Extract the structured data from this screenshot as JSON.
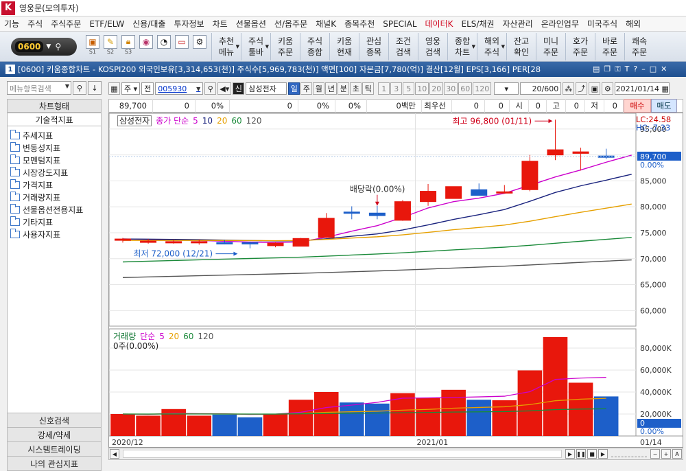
{
  "app": {
    "title": "영웅문(모의투자)",
    "logo_char": "K"
  },
  "menu": [
    "기능",
    "주식",
    "주식주문",
    "ETF/ELW",
    "신용/대출",
    "투자정보",
    "차트",
    "선물옵션",
    "선/옵주문",
    "채널K",
    "종목추천",
    "SPECIAL",
    "데이터K",
    "ELS/채권",
    "자산관리",
    "온라인업무",
    "미국주식",
    "해외"
  ],
  "menu_highlight": "데이터K",
  "toolbar": {
    "code": "0600",
    "quick_labels": [
      "S1",
      "S2",
      "S3"
    ],
    "buttons": [
      {
        "l1": "추천",
        "l2": "메뉴",
        "caret": true
      },
      {
        "l1": "주식",
        "l2": "툴바",
        "caret": true
      },
      {
        "l1": "키움",
        "l2": "주문"
      },
      {
        "l1": "주식",
        "l2": "종합"
      },
      {
        "l1": "키움",
        "l2": "현재"
      },
      {
        "l1": "관심",
        "l2": "종목"
      },
      {
        "l1": "조건",
        "l2": "검색"
      },
      {
        "l1": "영웅",
        "l2": "검색"
      },
      {
        "l1": "종합",
        "l2": "차트",
        "caret": true
      },
      {
        "l1": "해외",
        "l2": "주식",
        "caret": true
      },
      {
        "l1": "잔고",
        "l2": "확인"
      },
      {
        "l1": "미니",
        "l2": "주문"
      },
      {
        "l1": "호가",
        "l2": "주문"
      },
      {
        "l1": "바로",
        "l2": "주문"
      },
      {
        "l1": "쾌속",
        "l2": "주문"
      }
    ]
  },
  "window": {
    "number": "1",
    "title": "[0600] 키움종합차트 - KOSPI200 외국인보유[3,314,653(천)] 주식수[5,969,783(천)] 액면[100] 자본금[7,780(억)] 결산[12월] EPS[3,166] PER[28"
  },
  "sidebar": {
    "search_placeholder": "메뉴항목검색",
    "head1": "차트형태",
    "head2": "기술적지표",
    "tree": [
      "추세지표",
      "변동성지표",
      "모멘텀지표",
      "시장강도지표",
      "가격지표",
      "거래량지표",
      "선물옵션전용지표",
      "기타지표",
      "사용자지표"
    ],
    "bottom": [
      "신호검색",
      "강세/약세",
      "시스템트레이딩",
      "나의 관심지표"
    ]
  },
  "chart_toolbar": {
    "period": "주",
    "market": "전",
    "code": "005930",
    "credit": "신",
    "name": "삼성전자",
    "tabs": [
      "일",
      "주",
      "월",
      "년",
      "분",
      "초",
      "틱"
    ],
    "active_tab": "일",
    "intervals": [
      "1",
      "3",
      "5",
      "10",
      "20",
      "30",
      "60",
      "120"
    ],
    "count": "20",
    "count_total": "/600",
    "date": "2021/01/14"
  },
  "quote": {
    "price": "89,700",
    "v1": "0",
    "p1": "0%",
    "v2": "0",
    "p2": "0%",
    "p3": "0%",
    "amt": "0백만",
    "label": "최우선",
    "b1": "0",
    "b2": "0",
    "si_label": "시",
    "si": "0",
    "go_label": "고",
    "go": "0",
    "jeo_label": "저",
    "jeo": "0",
    "buy": "매수",
    "sell": "매도"
  },
  "price_panel": {
    "name": "삼성전자",
    "legend": [
      "종가 단순",
      "5",
      "10",
      "20",
      "60",
      "120"
    ],
    "legend_colors": [
      "#cc00cc",
      "#cc00cc",
      "#1a237e",
      "#e6a000",
      "#1b8a3a",
      "#555555"
    ],
    "lc": "LC:24.58",
    "hc": "HC:-7.33",
    "y_ticks": [
      "95,000",
      "90,000",
      "85,000",
      "80,000",
      "75,000",
      "70,000",
      "65,000",
      "60,000"
    ],
    "current": "89,700",
    "current_pct": "0.00%",
    "max_label": "최고 96,800 (01/11)",
    "min_label": "최저 72,000 (12/21)",
    "div_label": "배당락(0.00%)"
  },
  "volume_panel": {
    "title": "거래량",
    "legend": [
      "단순",
      "5",
      "20",
      "60",
      "120"
    ],
    "legend_colors": [
      "#cc00cc",
      "#cc00cc",
      "#e6a000",
      "#1b8a3a",
      "#555555"
    ],
    "info": "0주(0.00%)",
    "y_ticks": [
      "80,000K",
      "60,000K",
      "40,000K",
      "20,000K"
    ],
    "current": "0",
    "current_pct": "0.00%"
  },
  "x_axis": {
    "labels": [
      "2020/12",
      "2021/01"
    ],
    "last": "01/14"
  },
  "chart_data": {
    "type": "candlestick",
    "dates": [
      "12/14",
      "12/15",
      "12/16",
      "12/17",
      "12/18",
      "12/21",
      "12/22",
      "12/23",
      "12/24",
      "12/28",
      "12/29",
      "12/30",
      "01/04",
      "01/05",
      "01/06",
      "01/07",
      "01/08",
      "01/11",
      "01/12",
      "01/13",
      "01/14"
    ],
    "open": [
      73800,
      73300,
      73100,
      73300,
      73100,
      73100,
      72500,
      72400,
      74100,
      79000,
      78800,
      77400,
      81000,
      81600,
      83300,
      82700,
      83300,
      90000,
      90300,
      89800,
      89700
    ],
    "high": [
      74000,
      73800,
      73700,
      73700,
      73600,
      73300,
      73200,
      74000,
      78800,
      80100,
      80200,
      81300,
      84400,
      83900,
      84500,
      84200,
      90000,
      96800,
      91400,
      91200,
      89700
    ],
    "low": [
      73100,
      72900,
      72900,
      72700,
      72800,
      72000,
      72200,
      72400,
      74000,
      77600,
      77600,
      77300,
      80200,
      81600,
      82700,
      82700,
      83000,
      89000,
      87000,
      89200,
      89700
    ],
    "close": [
      73800,
      73400,
      73300,
      73300,
      73000,
      73000,
      73000,
      73900,
      77800,
      78800,
      78300,
      81000,
      83000,
      83900,
      82200,
      82900,
      88800,
      91000,
      90600,
      89700,
      89700
    ],
    "volume_k": [
      20000,
      18500,
      24500,
      18500,
      19500,
      17000,
      20000,
      33000,
      40000,
      30500,
      29500,
      39000,
      34500,
      42000,
      33000,
      32500,
      59700,
      90000,
      48500,
      36000,
      0
    ],
    "ma5_tail": [
      77900,
      79400,
      80100,
      81300,
      82200,
      82800,
      84100,
      86000,
      87300,
      88200,
      89700
    ],
    "ylim": [
      57000,
      97500
    ],
    "volume_ylim": [
      0,
      95000
    ]
  }
}
